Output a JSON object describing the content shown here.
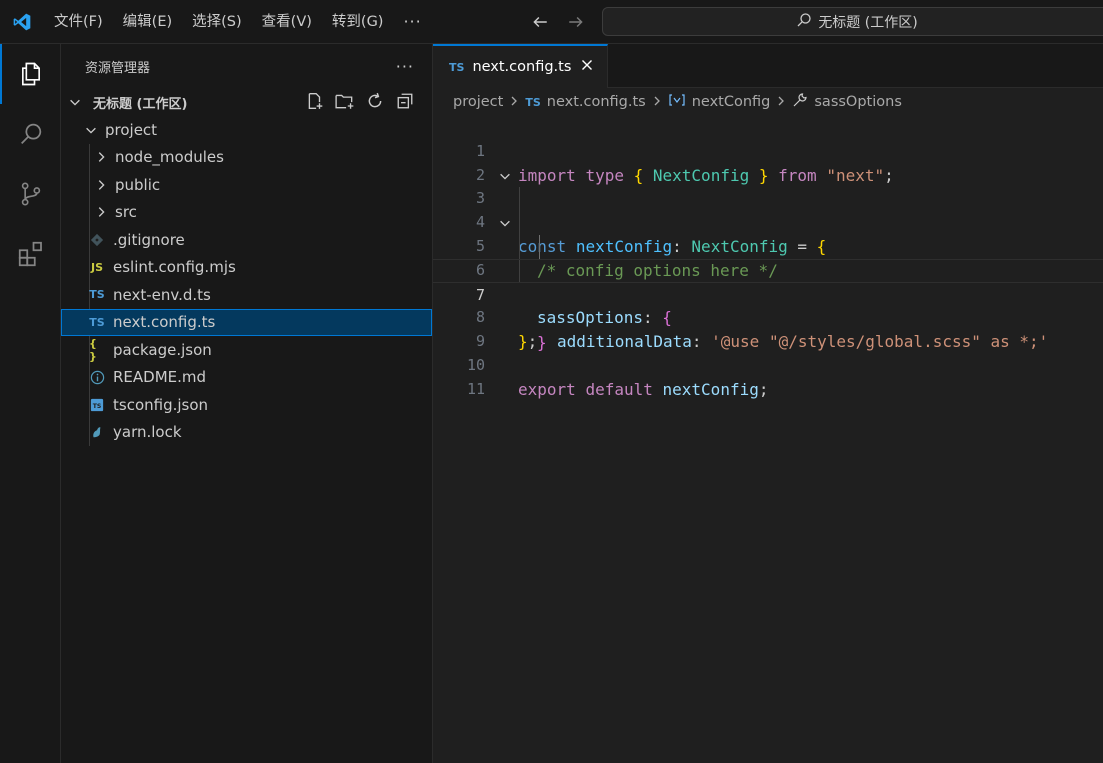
{
  "menu": [
    "文件(F)",
    "编辑(E)",
    "选择(S)",
    "查看(V)",
    "转到(G)"
  ],
  "menu_more": "···",
  "command_center": "无标题 (工作区)",
  "sidebar": {
    "title": "资源管理器",
    "more": "···",
    "workspace": "无标题 (工作区)",
    "root_folder": "project",
    "items": [
      {
        "label": "node_modules",
        "kind": "folder"
      },
      {
        "label": "public",
        "kind": "folder"
      },
      {
        "label": "src",
        "kind": "folder"
      },
      {
        "label": ".gitignore",
        "kind": "git"
      },
      {
        "label": "eslint.config.mjs",
        "kind": "js",
        "badge": "JS"
      },
      {
        "label": "next-env.d.ts",
        "kind": "ts",
        "badge": "TS"
      },
      {
        "label": "next.config.ts",
        "kind": "ts",
        "badge": "TS",
        "selected": true
      },
      {
        "label": "package.json",
        "kind": "json",
        "badge": "{ }"
      },
      {
        "label": "README.md",
        "kind": "info"
      },
      {
        "label": "tsconfig.json",
        "kind": "tsconfig",
        "badge": "TS"
      },
      {
        "label": "yarn.lock",
        "kind": "yarn"
      }
    ]
  },
  "tab": {
    "label": "next.config.ts",
    "badge": "TS"
  },
  "breadcrumb": {
    "folder": "project",
    "file": "next.config.ts",
    "symbol1": "nextConfig",
    "symbol2": "sassOptions"
  },
  "code": {
    "line_numbers": [
      "1",
      "2",
      "3",
      "4",
      "5",
      "6",
      "7",
      "8",
      "9",
      "10",
      "11"
    ],
    "current_line": 7,
    "l1": {
      "import": "import",
      "type": "type",
      "ob": "{",
      "name": "NextConfig",
      "cb": "}",
      "from": "from",
      "mod": "\"next\"",
      "semi": ";"
    },
    "l3": {
      "const": "const",
      "name": "nextConfig",
      "colon": ":",
      "type": "NextConfig",
      "eq": "=",
      "ob": "{"
    },
    "l4": {
      "comment": "/* config options here */"
    },
    "l5": {
      "name": "sassOptions",
      "colon": ":",
      "ob": "{"
    },
    "l6": {
      "name": "additionalData",
      "colon": ":",
      "value": "'@use \"@/styles/global.scss\" as *;'"
    },
    "l7": {
      "cb": "}"
    },
    "l8": {
      "cb": "}",
      "semi": ";"
    },
    "l10": {
      "export": "export",
      "default": "default",
      "name": "nextConfig",
      "semi": ";"
    }
  },
  "colors": {
    "accent": "#0078d4",
    "selection": "#04395e",
    "ts_blue": "#4d9bd6",
    "js_yellow": "#cbcb41"
  }
}
